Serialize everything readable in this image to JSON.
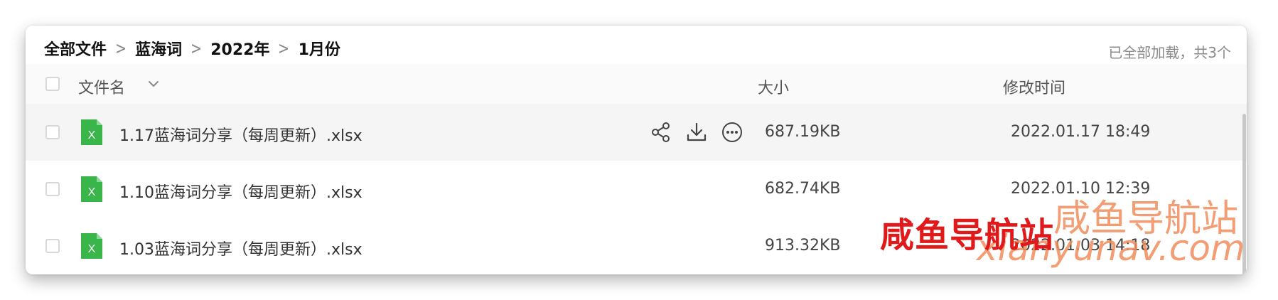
{
  "breadcrumb": {
    "items": [
      "全部文件",
      "蓝海词",
      "2022年",
      "1月份"
    ]
  },
  "load_status": "已全部加载，共3个",
  "columns": {
    "name": "文件名",
    "size": "大小",
    "modified": "修改时间"
  },
  "files": [
    {
      "icon": "excel-file-icon",
      "icon_letter": "X",
      "name": "1.17蓝海词分享（每周更新）.xlsx",
      "size": "687.19KB",
      "modified": "2022.01.17 18:49",
      "hovered": true
    },
    {
      "icon": "excel-file-icon",
      "icon_letter": "X",
      "name": "1.10蓝海词分享（每周更新）.xlsx",
      "size": "682.74KB",
      "modified": "2022.01.10 12:39",
      "hovered": false
    },
    {
      "icon": "excel-file-icon",
      "icon_letter": "X",
      "name": "1.03蓝海词分享（每周更新）.xlsx",
      "size": "913.32KB",
      "modified": "2022.01.03 14:18",
      "hovered": false
    }
  ],
  "row_actions": [
    "share-icon",
    "download-icon",
    "more-icon"
  ],
  "watermarks": {
    "red_text": "咸鱼导航站",
    "orange_text": "咸鱼导航站",
    "url_text": "xianyunav.com"
  },
  "colors": {
    "excel_green": "#39b54a",
    "watermark_red": "#e01a1a",
    "watermark_orange": "#f08c5a",
    "hover_row": "#f5f5f5"
  }
}
